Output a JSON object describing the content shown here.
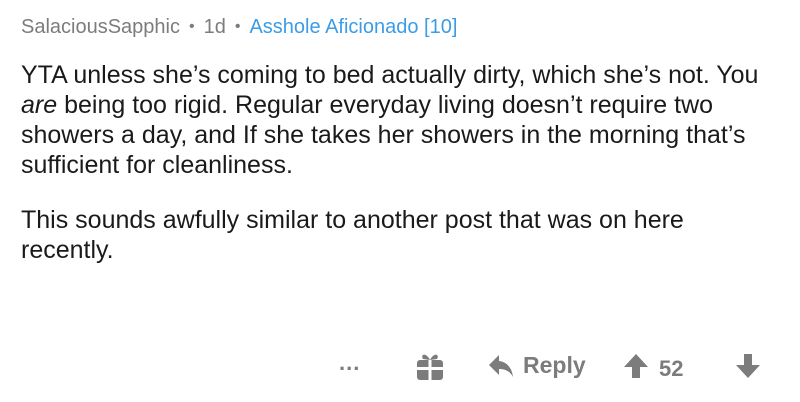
{
  "comment": {
    "author": "SalaciousSapphic",
    "separator": "•",
    "age": "1d",
    "flair": "Asshole Aficionado [10]",
    "paragraph1_part1": "YTA unless she’s coming to bed actually dirty, which she’s not. You ",
    "paragraph1_emphasis": "are",
    "paragraph1_part2": " being too rigid. Regular everyday living doesn’t require two showers a day, and If she takes her showers in the morning that’s sufficient for cleanliness.",
    "paragraph2": "This sounds awfully similar to another post that was on here recently."
  },
  "actions": {
    "more_label": "...",
    "reply_label": "Reply",
    "score": "52"
  },
  "colors": {
    "meta_gray": "#7c7c7c",
    "flair_blue": "#3d9ce5",
    "text": "#1a1a1b"
  }
}
